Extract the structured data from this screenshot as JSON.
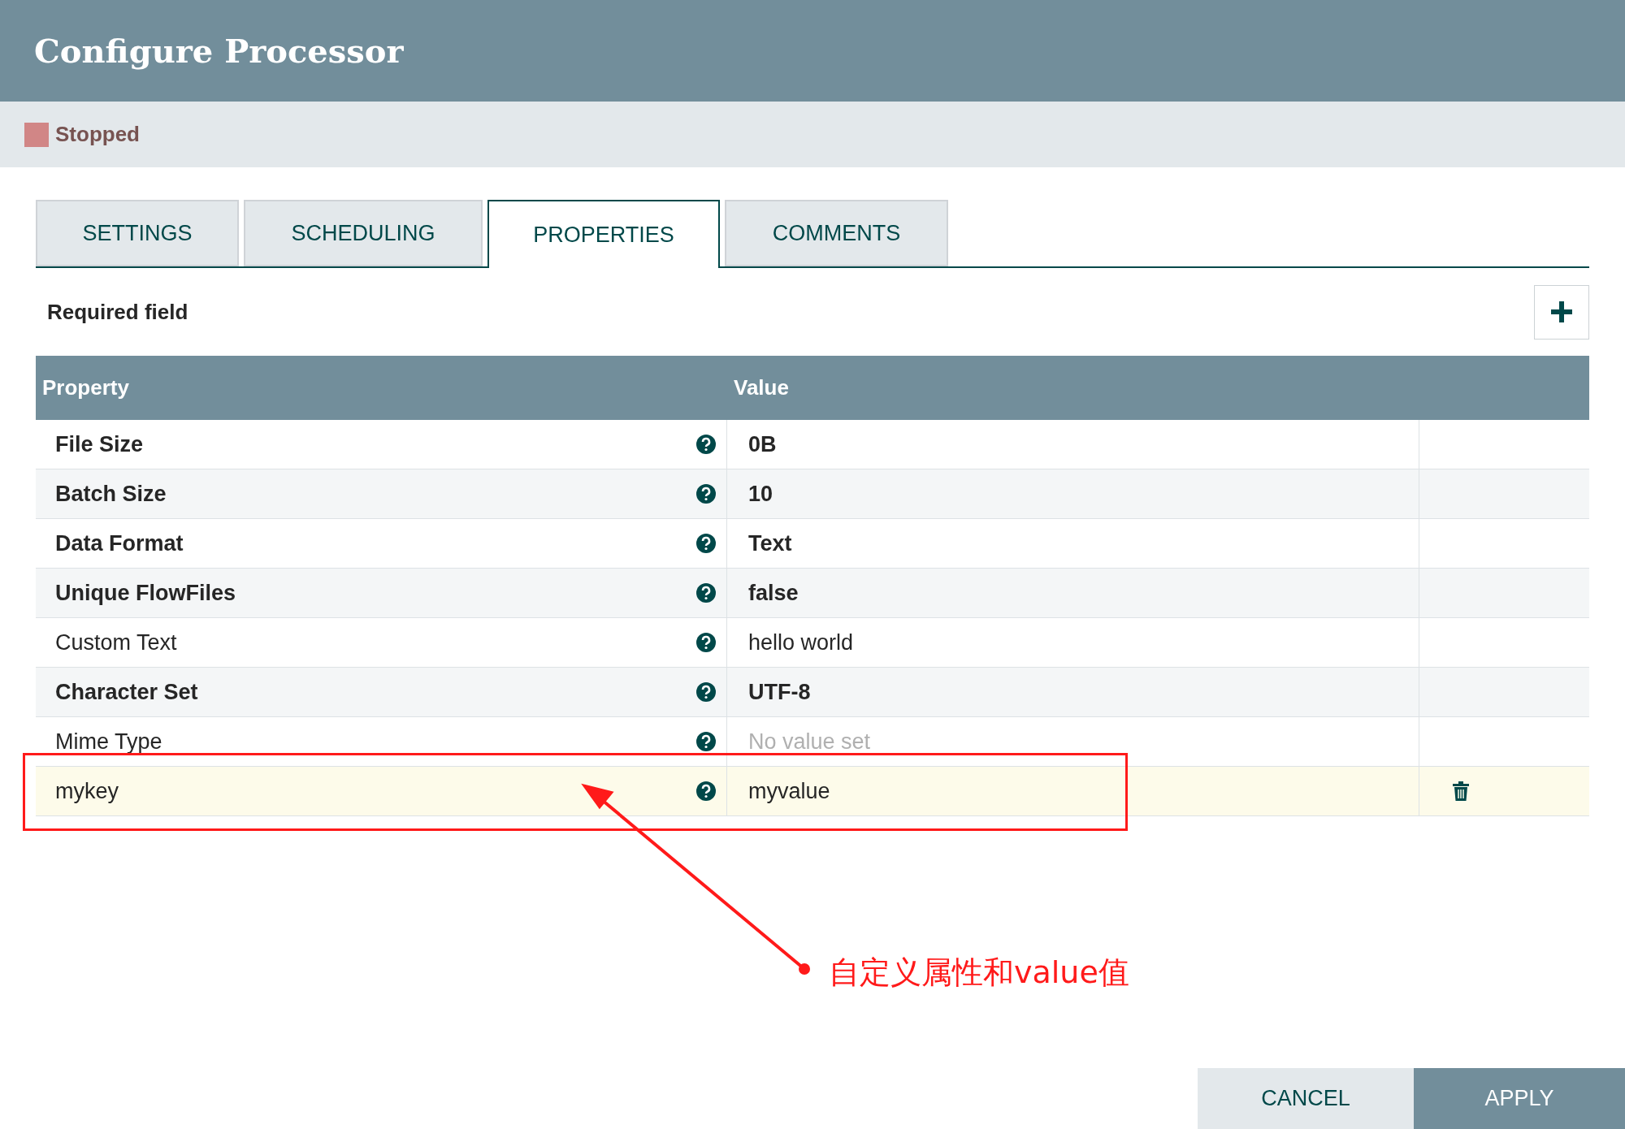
{
  "window": {
    "title": "Configure Processor"
  },
  "status": {
    "label": "Stopped",
    "color": "#d18686"
  },
  "tabs": [
    {
      "label": "SETTINGS",
      "selected": false
    },
    {
      "label": "SCHEDULING",
      "selected": false
    },
    {
      "label": "PROPERTIES",
      "selected": true
    },
    {
      "label": "COMMENTS",
      "selected": false
    }
  ],
  "required_note": "Required field",
  "table": {
    "columns": [
      "Property",
      "Value"
    ],
    "rows": [
      {
        "property": "File Size",
        "value": "0B",
        "required": true,
        "value_set": true,
        "kind": "standard"
      },
      {
        "property": "Batch Size",
        "value": "10",
        "required": true,
        "value_set": true,
        "kind": "standard"
      },
      {
        "property": "Data Format",
        "value": "Text",
        "required": true,
        "value_set": true,
        "kind": "standard"
      },
      {
        "property": "Unique FlowFiles",
        "value": "false",
        "required": true,
        "value_set": true,
        "kind": "standard"
      },
      {
        "property": "Custom Text",
        "value": "hello world",
        "required": false,
        "value_set": true,
        "kind": "standard"
      },
      {
        "property": "Character Set",
        "value": "UTF-8",
        "required": true,
        "value_set": true,
        "kind": "standard"
      },
      {
        "property": "Mime Type",
        "value": "No value set",
        "required": false,
        "value_set": false,
        "kind": "standard"
      },
      {
        "property": "mykey",
        "value": "myvalue",
        "required": false,
        "value_set": true,
        "kind": "dynamic"
      }
    ]
  },
  "annotation": {
    "text": "自定义属性和value值"
  },
  "buttons": [
    {
      "label": "CANCEL",
      "kind": "secondary"
    },
    {
      "label": "APPLY",
      "kind": "primary"
    }
  ]
}
